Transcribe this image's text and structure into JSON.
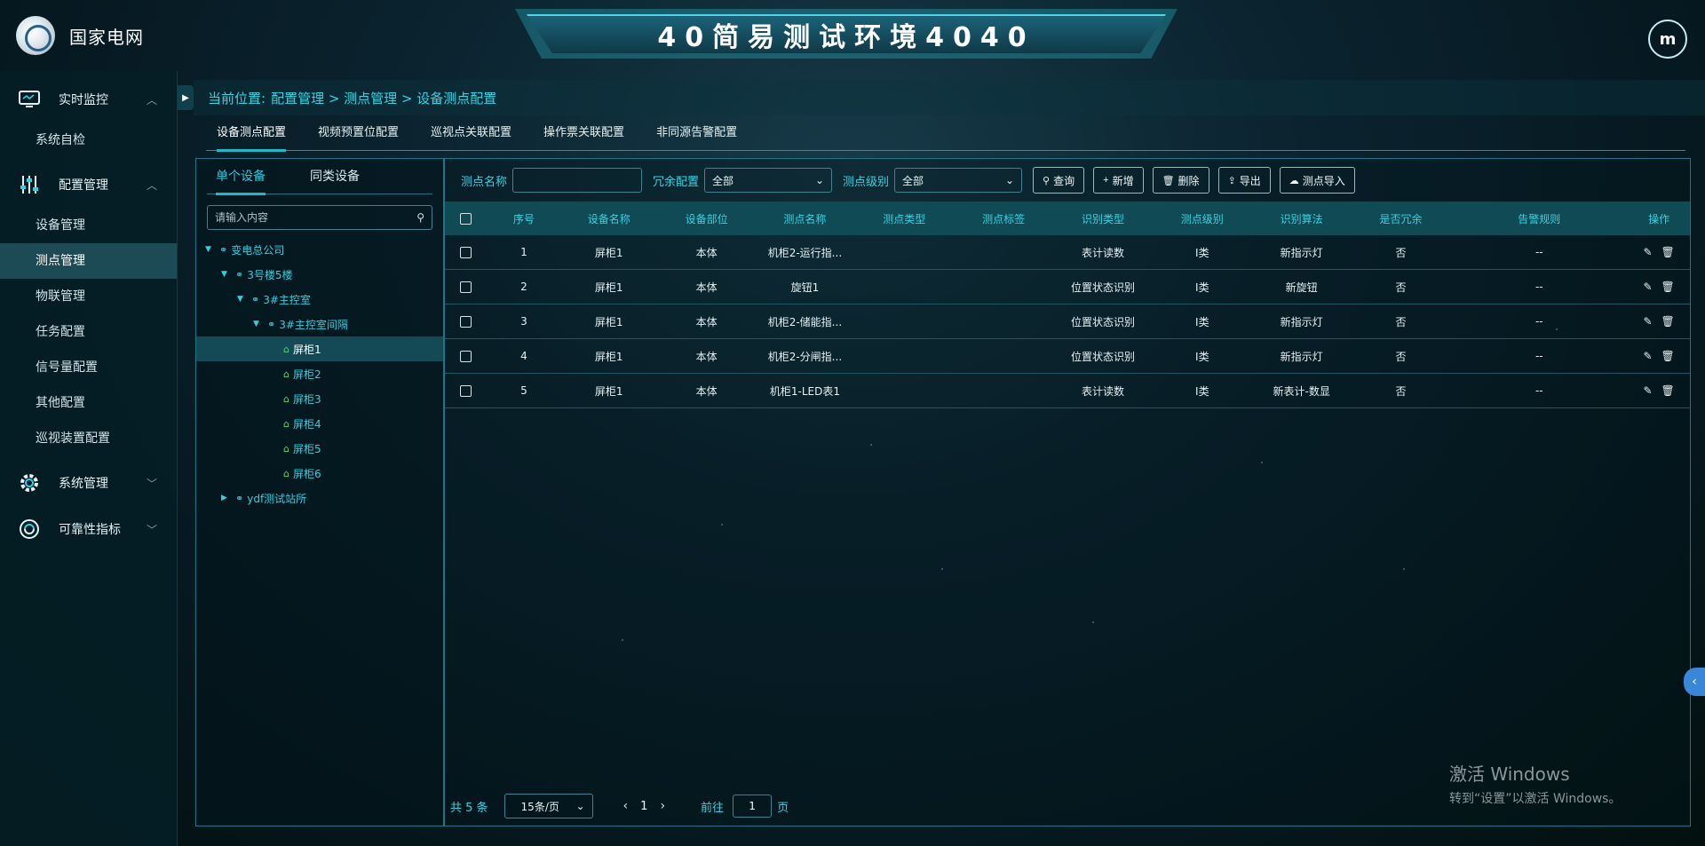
{
  "header": {
    "org_name": "国家电网",
    "system_title": "40简易测试环境4040",
    "avatar_initial": "m"
  },
  "sidebar": {
    "groups": [
      {
        "label": "实时监控",
        "icon": "monitor-icon",
        "expanded": true,
        "items": [
          "系统自检"
        ]
      },
      {
        "label": "配置管理",
        "icon": "sliders-icon",
        "expanded": true,
        "items": [
          "设备管理",
          "测点管理",
          "物联管理",
          "任务配置",
          "信号量配置",
          "其他配置",
          "巡视装置配置"
        ]
      },
      {
        "label": "系统管理",
        "icon": "gear-icon",
        "expanded": false,
        "items": []
      },
      {
        "label": "可靠性指标",
        "icon": "target-icon",
        "expanded": false,
        "items": []
      }
    ],
    "active_item": "测点管理"
  },
  "breadcrumb": {
    "prefix": "当前位置:",
    "path": "配置管理 > 测点管理 > 设备测点配置"
  },
  "top_tabs": [
    "设备测点配置",
    "视频预置位配置",
    "巡视点关联配置",
    "操作票关联配置",
    "非同源告警配置"
  ],
  "active_top_tab": "设备测点配置",
  "tree": {
    "tabs": [
      "单个设备",
      "同类设备"
    ],
    "active_tab": "单个设备",
    "search_placeholder": "请输入内容",
    "nodes": [
      {
        "label": "变电总公司",
        "level": 0,
        "caret": "▼",
        "icon": "org-icon"
      },
      {
        "label": "3号楼5楼",
        "level": 1,
        "caret": "▼",
        "icon": "org-icon"
      },
      {
        "label": "3#主控室",
        "level": 2,
        "caret": "▼",
        "icon": "org-icon"
      },
      {
        "label": "3#主控室间隔",
        "level": 3,
        "caret": "▼",
        "icon": "org-icon"
      },
      {
        "label": "屏柜1",
        "level": 4,
        "caret": "",
        "icon": "cabinet-icon",
        "selected": true
      },
      {
        "label": "屏柜2",
        "level": 4,
        "caret": "",
        "icon": "cabinet-icon"
      },
      {
        "label": "屏柜3",
        "level": 4,
        "caret": "",
        "icon": "cabinet-icon"
      },
      {
        "label": "屏柜4",
        "level": 4,
        "caret": "",
        "icon": "cabinet-icon"
      },
      {
        "label": "屏柜5",
        "level": 4,
        "caret": "",
        "icon": "cabinet-icon"
      },
      {
        "label": "屏柜6",
        "level": 4,
        "caret": "",
        "icon": "cabinet-icon"
      },
      {
        "label": "ydf测试站所",
        "level": 1,
        "caret": "▶",
        "icon": "org-icon"
      }
    ]
  },
  "filters": {
    "point_name_label": "测点名称",
    "point_name_value": "",
    "redundancy_label": "冗余配置",
    "redundancy_value": "全部",
    "level_label": "测点级别",
    "level_value": "全部"
  },
  "buttons": {
    "query": "查询",
    "add": "新增",
    "delete": "删除",
    "export": "导出",
    "import": "测点导入"
  },
  "table": {
    "columns": [
      "序号",
      "设备名称",
      "设备部位",
      "测点名称",
      "测点类型",
      "测点标签",
      "识别类型",
      "测点级别",
      "识别算法",
      "是否冗余",
      "告警规则",
      "操作"
    ],
    "rows": [
      {
        "no": "1",
        "device": "屏柜1",
        "part": "本体",
        "name": "机柜2-运行指...",
        "type": "",
        "tag": "",
        "rtype": "表计读数",
        "level": "Ⅰ类",
        "alg": "新指示灯",
        "redundant": "否",
        "rule": "--"
      },
      {
        "no": "2",
        "device": "屏柜1",
        "part": "本体",
        "name": "旋钮1",
        "type": "",
        "tag": "",
        "rtype": "位置状态识别",
        "level": "Ⅰ类",
        "alg": "新旋钮",
        "redundant": "否",
        "rule": "--"
      },
      {
        "no": "3",
        "device": "屏柜1",
        "part": "本体",
        "name": "机柜2-储能指...",
        "type": "",
        "tag": "",
        "rtype": "位置状态识别",
        "level": "Ⅰ类",
        "alg": "新指示灯",
        "redundant": "否",
        "rule": "--"
      },
      {
        "no": "4",
        "device": "屏柜1",
        "part": "本体",
        "name": "机柜2-分闸指...",
        "type": "",
        "tag": "",
        "rtype": "位置状态识别",
        "level": "Ⅰ类",
        "alg": "新指示灯",
        "redundant": "否",
        "rule": "--"
      },
      {
        "no": "5",
        "device": "屏柜1",
        "part": "本体",
        "name": "机柜1-LED表1",
        "type": "",
        "tag": "",
        "rtype": "表计读数",
        "level": "Ⅰ类",
        "alg": "新表计-数显",
        "redundant": "否",
        "rule": "--"
      }
    ]
  },
  "pager": {
    "total_text": "共 5 条",
    "page_size": "15条/页",
    "current_page": "1",
    "goto_prefix": "前往",
    "goto_value": "1",
    "goto_suffix": "页"
  },
  "watermark": {
    "line1": "激活 Windows",
    "line2": "转到“设置”以激活 Windows。"
  },
  "colors": {
    "accent": "#36d3e2",
    "active_tab_underline": "#1fb8c8",
    "table_header_bg": "#0f4a55",
    "leaf_icon": "#52d873"
  }
}
